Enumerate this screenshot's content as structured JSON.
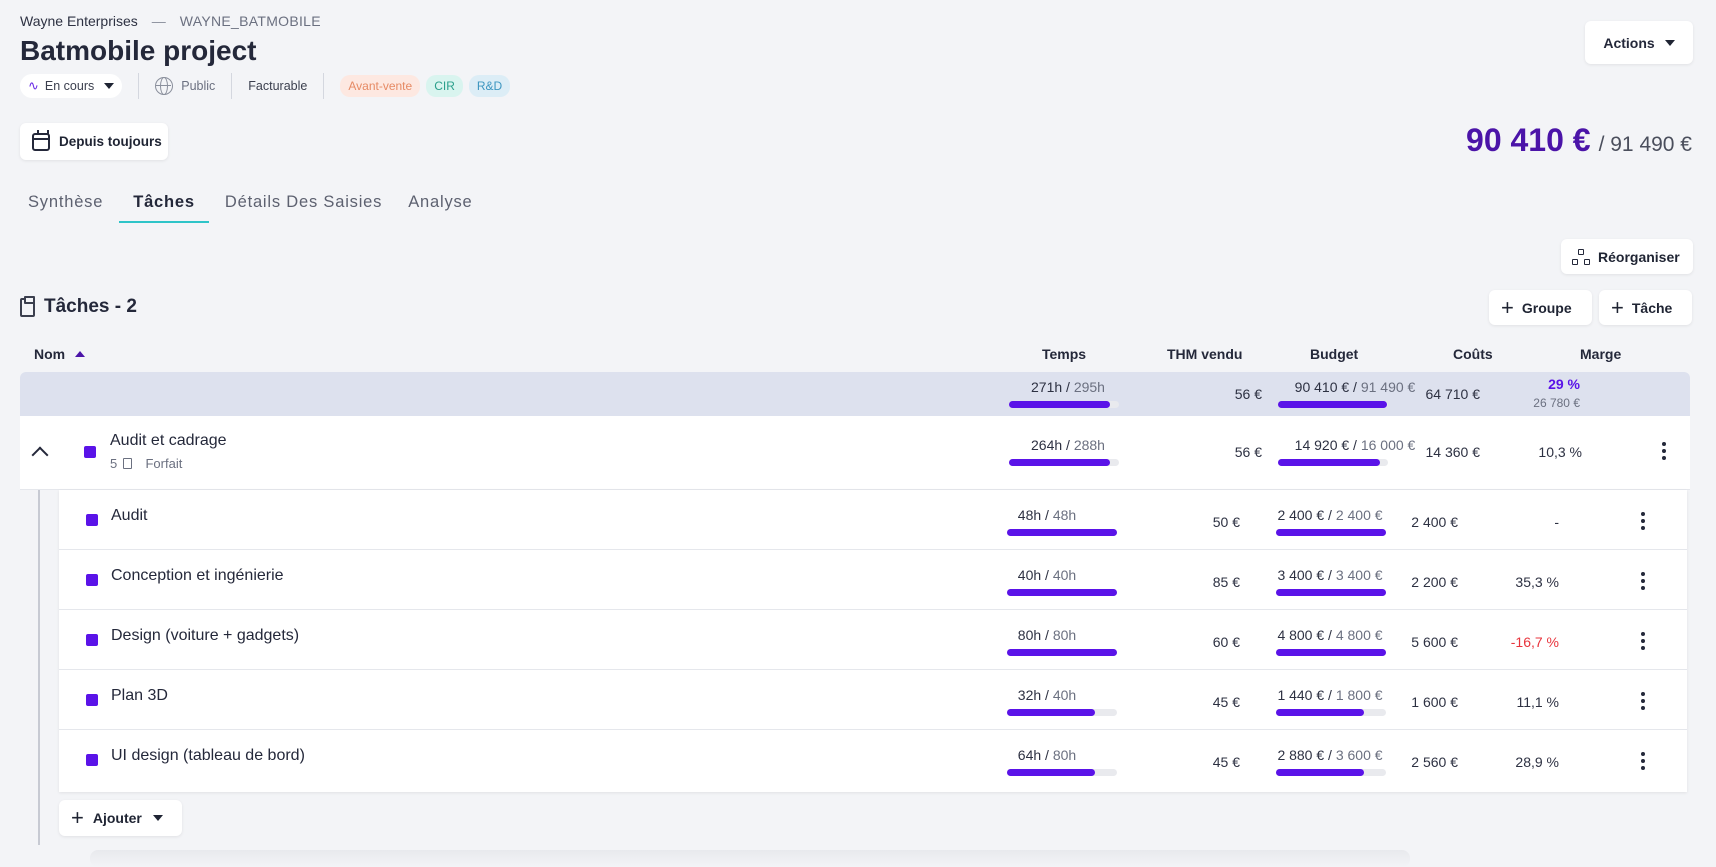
{
  "breadcrumb": {
    "org": "Wayne Enterprises",
    "separator": "—",
    "code": "WAYNE_BATMOBILE"
  },
  "project": {
    "title": "Batmobile project",
    "status": "En cours",
    "visibility": "Public",
    "billing": "Facturable",
    "tags": [
      "Avant-vente",
      "CIR",
      "R&D"
    ]
  },
  "actions": {
    "label": "Actions"
  },
  "period": {
    "label": "Depuis toujours"
  },
  "totals": {
    "amount": "90 410 €",
    "budget": "/ 91 490 €"
  },
  "tabs": [
    "Synthèse",
    "Tâches",
    "Détails Des Saisies",
    "Analyse"
  ],
  "active_tab": "Tâches",
  "reorganize": {
    "label": "Réorganiser"
  },
  "section": {
    "title": "Tâches - 2",
    "add_group": "Groupe",
    "add_task": "Tâche"
  },
  "columns": {
    "name": "Nom",
    "time": "Temps",
    "thm": "THM vendu",
    "budget": "Budget",
    "costs": "Coûts",
    "margin": "Marge"
  },
  "summary": {
    "time_spent": "271h",
    "time_total": "295h",
    "time_progress": 0.92,
    "thm": "56 €",
    "budget_spent": "90 410 €",
    "budget_total": "91 490 €",
    "budget_progress": 0.99,
    "costs": "64 710 €",
    "margin_pct": "29 %",
    "margin_amount": "26 780 €"
  },
  "group": {
    "name": "Audit et cadrage",
    "count": "5",
    "type": "Forfait",
    "time_spent": "264h",
    "time_total": "288h",
    "time_progress": 0.92,
    "thm": "56 €",
    "budget_spent": "14 920 €",
    "budget_total": "16 000 €",
    "budget_progress": 0.93,
    "costs": "14 360 €",
    "margin": "10,3 %"
  },
  "tasks": [
    {
      "name": "Audit",
      "time_spent": "48h",
      "time_total": "48h",
      "time_progress": 1.0,
      "thm": "50 €",
      "budget_spent": "2 400 €",
      "budget_total": "2 400 €",
      "budget_progress": 1.0,
      "costs": "2 400 €",
      "margin": "-",
      "margin_color": "#2d3142"
    },
    {
      "name": "Conception et ingénierie",
      "time_spent": "40h",
      "time_total": "40h",
      "time_progress": 1.0,
      "thm": "85 €",
      "budget_spent": "3 400 €",
      "budget_total": "3 400 €",
      "budget_progress": 1.0,
      "costs": "2 200 €",
      "margin": "35,3 %",
      "margin_color": "#2d3142"
    },
    {
      "name": "Design (voiture + gadgets)",
      "time_spent": "80h",
      "time_total": "80h",
      "time_progress": 1.0,
      "thm": "60 €",
      "budget_spent": "4 800 €",
      "budget_total": "4 800 €",
      "budget_progress": 1.0,
      "costs": "5 600 €",
      "margin": "-16,7 %",
      "margin_color": "#e8343c"
    },
    {
      "name": "Plan 3D",
      "time_spent": "32h",
      "time_total": "40h",
      "time_progress": 0.8,
      "thm": "45 €",
      "budget_spent": "1 440 €",
      "budget_total": "1 800 €",
      "budget_progress": 0.8,
      "costs": "1 600 €",
      "margin": "11,1 %",
      "margin_color": "#2d3142"
    },
    {
      "name": "UI design (tableau de bord)",
      "time_spent": "64h",
      "time_total": "80h",
      "time_progress": 0.8,
      "thm": "45 €",
      "budget_spent": "2 880 €",
      "budget_total": "3 600 €",
      "budget_progress": 0.8,
      "costs": "2 560 €",
      "margin": "28,9 %",
      "margin_color": "#2d3142"
    }
  ],
  "add_menu": {
    "label": "Ajouter"
  },
  "colors": {
    "accent": "#5a13e8",
    "total": "#4b14a8",
    "tab_underline": "#2ec4c8",
    "negative": "#e8343c"
  }
}
